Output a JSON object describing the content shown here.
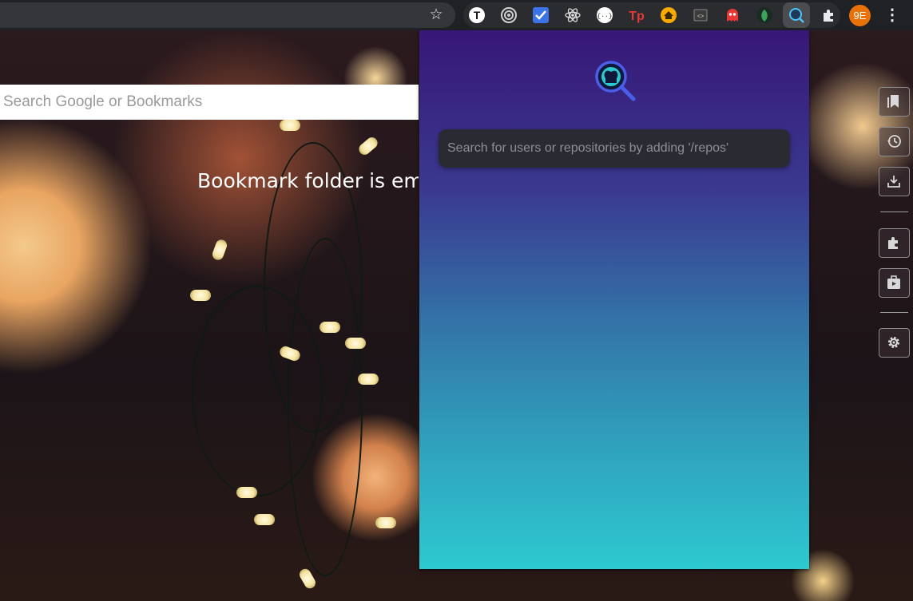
{
  "toolbar": {
    "bookmark_star_icon": "star-outline-icon",
    "extensions": [
      {
        "name": "t-extension-icon",
        "letter": "T",
        "color": "#ffffff"
      },
      {
        "name": "target-extension-icon",
        "color": "#cfcfcf"
      },
      {
        "name": "checklist-extension-icon",
        "color": "#4285f4"
      },
      {
        "name": "react-devtools-icon",
        "color": "#61dafb"
      },
      {
        "name": "json-extension-icon",
        "letter": "{···}",
        "color": "#ffffff"
      },
      {
        "name": "tp-extension-icon",
        "letter": "Tp",
        "color": "#e53935"
      },
      {
        "name": "home-extension-icon",
        "color": "#f9ab00"
      },
      {
        "name": "code-extension-icon",
        "letter": "<>",
        "color": "#cfcfcf"
      },
      {
        "name": "ghost-extension-icon",
        "color": "#e53935"
      },
      {
        "name": "leaf-extension-icon",
        "color": "#2e7d32"
      },
      {
        "name": "github-search-extension-icon",
        "color": "#4fc3f7"
      }
    ],
    "puzzle_icon": "puzzle-icon",
    "avatar_label": "9E",
    "avatar_color": "#e8710a",
    "menu_icon": "kebab-menu-icon"
  },
  "page": {
    "search_placeholder": "Search Google or Bookmarks",
    "empty_message": "Bookmark folder is empty"
  },
  "side_panel": {
    "buttons": [
      {
        "name": "bookmarks-icon"
      },
      {
        "name": "history-icon"
      },
      {
        "name": "downloads-icon"
      },
      {
        "name": "extensions-icon"
      },
      {
        "name": "apps-icon"
      },
      {
        "name": "settings-icon"
      }
    ]
  },
  "popup": {
    "logo_icon": "github-search-logo-icon",
    "search_placeholder": "Search for users or repositories by adding '/repos'",
    "gradient_top": "#371777",
    "gradient_bottom": "#2dc9d0"
  }
}
